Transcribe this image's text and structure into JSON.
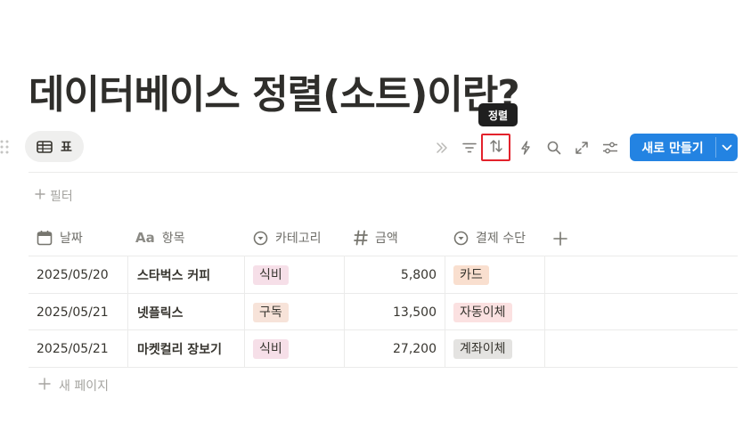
{
  "page": {
    "title": "데이터베이스 정렬(소트)이란?"
  },
  "view": {
    "tab_label": "표"
  },
  "toolbar": {
    "tooltip": "정렬",
    "new_button_label": "새로 만들기",
    "icons": [
      "chevrons-right-icon",
      "filter-icon",
      "sort-icon",
      "lightning-icon",
      "search-icon",
      "expand-icon",
      "settings-sliders-icon"
    ]
  },
  "filter": {
    "label": "필터"
  },
  "table": {
    "columns": [
      {
        "label": "날짜",
        "icon": "calendar-icon"
      },
      {
        "label": "항목",
        "icon": "text-icon"
      },
      {
        "label": "카테고리",
        "icon": "select-icon"
      },
      {
        "label": "금액",
        "icon": "number-icon"
      },
      {
        "label": "결제 수단",
        "icon": "select-icon"
      }
    ],
    "rows": [
      {
        "date": "2025/05/20",
        "item": "스타벅스 커피",
        "category": "식비",
        "amount": "5,800",
        "payment": "카드"
      },
      {
        "date": "2025/05/21",
        "item": "넷플릭스",
        "category": "구독",
        "amount": "13,500",
        "payment": "자동이체"
      },
      {
        "date": "2025/05/21",
        "item": "마켓컬리 장보기",
        "category": "식비",
        "amount": "27,200",
        "payment": "계좌이체"
      }
    ],
    "new_page_label": "새 페이지"
  },
  "colors": {
    "accent": "#2383e2",
    "highlight": "#e3222c",
    "tag_food": "#f6dfe8",
    "tag_subscription": "#f7e3d9",
    "tag_card": "#f9dfcf",
    "tag_autopay": "#fbe1e1",
    "tag_transfer": "#e4e3e1"
  }
}
